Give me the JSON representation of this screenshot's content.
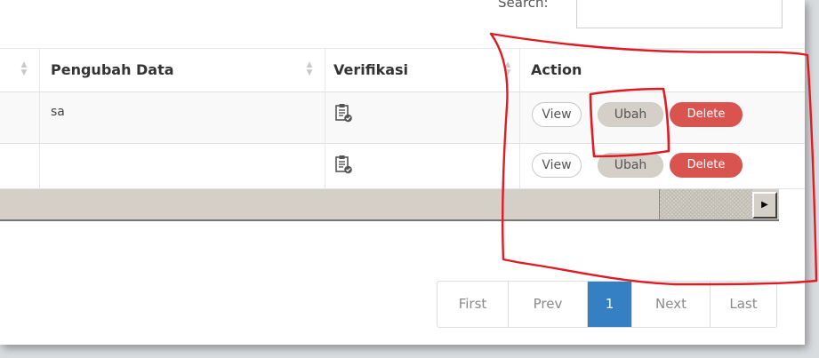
{
  "search": {
    "label": "Search:",
    "value": ""
  },
  "table": {
    "headers": [
      "Pengubah Data",
      "Verifikasi",
      "Action"
    ],
    "rows": [
      {
        "pengubah": "sa",
        "verifikasi_icon": "clipboard-check-icon"
      },
      {
        "pengubah": "",
        "verifikasi_icon": "clipboard-check-icon"
      }
    ],
    "actions": {
      "view": "View",
      "ubah": "Ubah",
      "delete": "Delete"
    }
  },
  "pagination": {
    "first": "First",
    "prev": "Prev",
    "current": "1",
    "next": "Next",
    "last": "Last"
  },
  "colors": {
    "delete": "#d9534f",
    "ubah": "#d4d0c7",
    "active_page": "#3580c3",
    "annotation": "#e01b24"
  }
}
